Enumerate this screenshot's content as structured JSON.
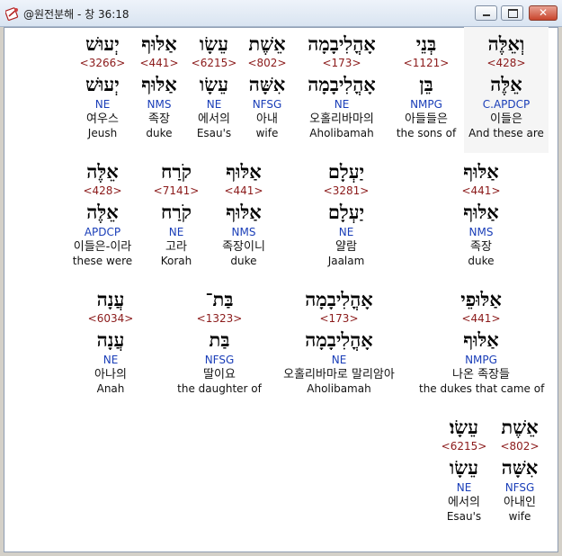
{
  "window": {
    "title": "@원전분해 - 창 36:18",
    "minimize_label": "",
    "maximize_label": "",
    "close_label": "✕"
  },
  "rows": [
    [
      {
        "heb": "וְאֵלֶּה",
        "strong": "<428>",
        "root": "אֵלֶּה",
        "morph": "C.APDCP",
        "kor": "이들은",
        "eng": "And these are"
      },
      {
        "heb": "בְּנֵי",
        "strong": "<1121>",
        "root": "בֵּן",
        "morph": "NMPG",
        "kor": "아들들은",
        "eng": "the sons of"
      },
      {
        "heb": "אָהֳלִיבָמָה",
        "strong": "<173>",
        "root": "אָהֳלִיבָמָה",
        "morph": "NE",
        "kor": "오홀리바마의",
        "eng": "Aholibamah"
      },
      {
        "heb": "אֵשֶׁת",
        "strong": "<802>",
        "root": "אִשָּׁה",
        "morph": "NFSG",
        "kor": "아내",
        "eng": "wife"
      },
      {
        "heb": "עֵשָׂו",
        "strong": "<6215>",
        "root": "עֵשָׂו",
        "morph": "NE",
        "kor": "에서의",
        "eng": "Esau's"
      },
      {
        "heb": "אַלּוּף",
        "strong": "<441>",
        "root": "אַלּוּף",
        "morph": "NMS",
        "kor": "족장",
        "eng": "duke"
      },
      {
        "heb": "יְעוּשׁ",
        "strong": "<3266>",
        "root": "יְעוּשׁ",
        "morph": "NE",
        "kor": "여우스",
        "eng": "Jeush"
      }
    ],
    [
      {
        "heb": "אַלּוּף",
        "strong": "<441>",
        "root": "אַלּוּף",
        "morph": "NMS",
        "kor": "족장",
        "eng": "duke"
      },
      {
        "heb": "יַעְלָם",
        "strong": "<3281>",
        "root": "יַעְלָם",
        "morph": "NE",
        "kor": "얄람",
        "eng": "Jaalam"
      },
      {
        "heb": "אַלּוּף",
        "strong": "<441>",
        "root": "אַלּוּף",
        "morph": "NMS",
        "kor": "족장이니",
        "eng": "duke"
      },
      {
        "heb": "קֹרַח",
        "strong": "<7141>",
        "root": "קֹרַח",
        "morph": "NE",
        "kor": "고라",
        "eng": "Korah"
      },
      {
        "heb": "אֵלֶּה",
        "strong": "<428>",
        "root": "אֵלֶּה",
        "morph": "APDCP",
        "kor": "이들은-이라",
        "eng": "these were"
      }
    ],
    [
      {
        "heb": "אַלּוּפֵי",
        "strong": "<441>",
        "root": "אַלּוּף",
        "morph": "NMPG",
        "kor": "나온 족장들",
        "eng": "the dukes that came of"
      },
      {
        "heb": "אָהֳלִיבָמָה",
        "strong": "<173>",
        "root": "אָהֳלִיבָמָה",
        "morph": "NE",
        "kor": "오홀리바마로 말리암아",
        "eng": "Aholibamah"
      },
      {
        "heb": "בַּת־",
        "strong": "<1323>",
        "root": "בַּת",
        "morph": "NFSG",
        "kor": "딸이요",
        "eng": "the daughter of"
      },
      {
        "heb": "עֲנָה",
        "strong": "<6034>",
        "root": "עֲנָה",
        "morph": "NE",
        "kor": "아나의",
        "eng": "Anah"
      }
    ],
    [
      {
        "heb": "אֵשֶׁת",
        "strong": "<802>",
        "root": "אִשָּׁה",
        "morph": "NFSG",
        "kor": "아내인",
        "eng": "wife"
      },
      {
        "heb": "עֵשָׂו׃",
        "strong": "<6215>",
        "root": "עֵשָׂו",
        "morph": "NE",
        "kor": "에서의",
        "eng": "Esau's"
      }
    ]
  ]
}
